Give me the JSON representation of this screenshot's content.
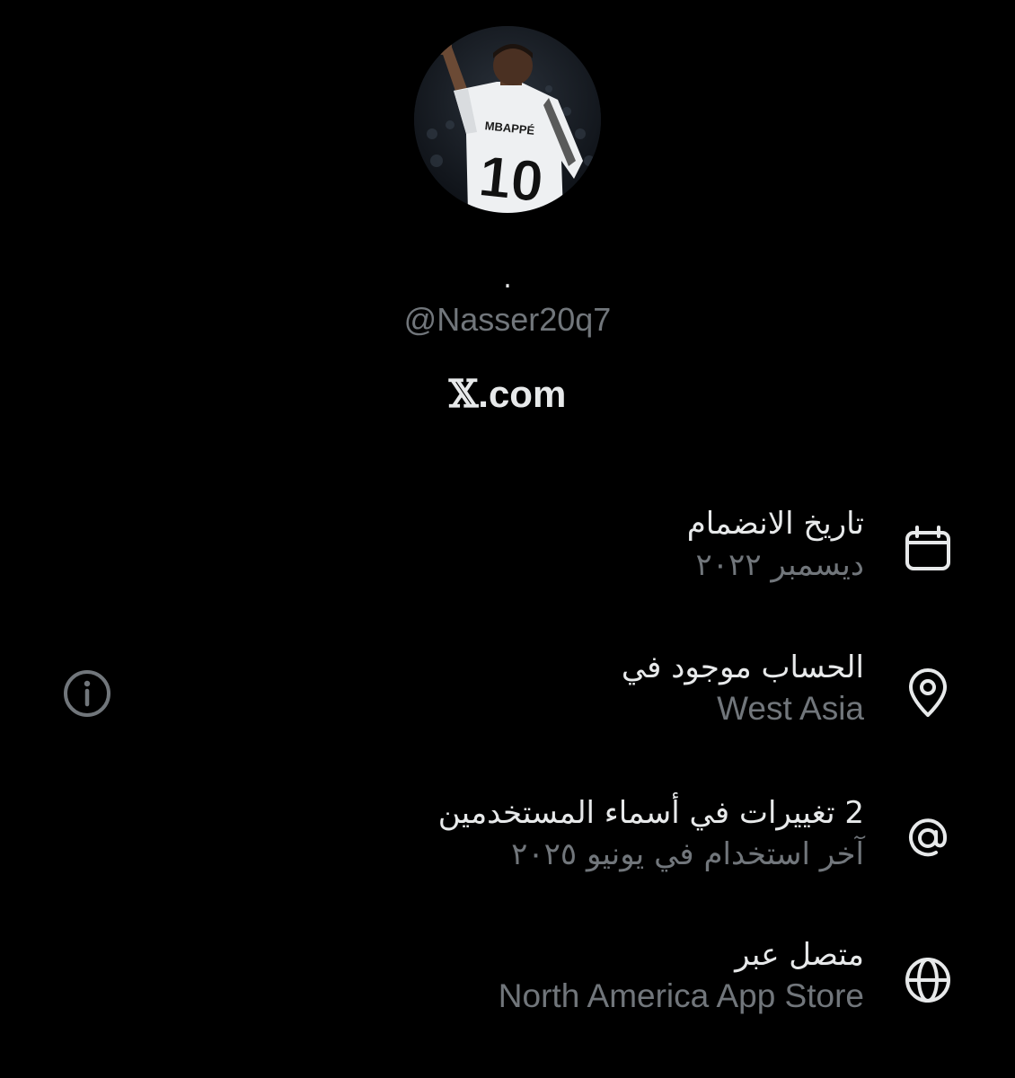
{
  "profile": {
    "avatar_alt": "profile-photo",
    "jersey_name": "MBAPPÉ",
    "jersey_number": "10",
    "display_name": ".",
    "handle": "@Nasser20q7",
    "platform_mark": "𝕏",
    "platform_suffix": ".com"
  },
  "about": {
    "joined": {
      "label": "تاريخ الانضمام",
      "value": "ديسمبر ٢٠٢٢",
      "icon": "calendar-icon"
    },
    "location": {
      "label": "الحساب موجود في",
      "value": "West Asia",
      "icon": "location-pin-icon"
    },
    "usernames": {
      "label": "2 تغييرات في أسماء المستخدمين",
      "value": "آخر استخدام في يونيو ٢٠٢٥",
      "icon": "at-sign-icon"
    },
    "connected": {
      "label": "متصل عبر",
      "value": "North America App Store",
      "icon": "globe-icon"
    }
  },
  "colors": {
    "background": "#000000",
    "primary_text": "#e7e9ea",
    "secondary_text": "#71767b",
    "icon": "#e7e9ea"
  }
}
